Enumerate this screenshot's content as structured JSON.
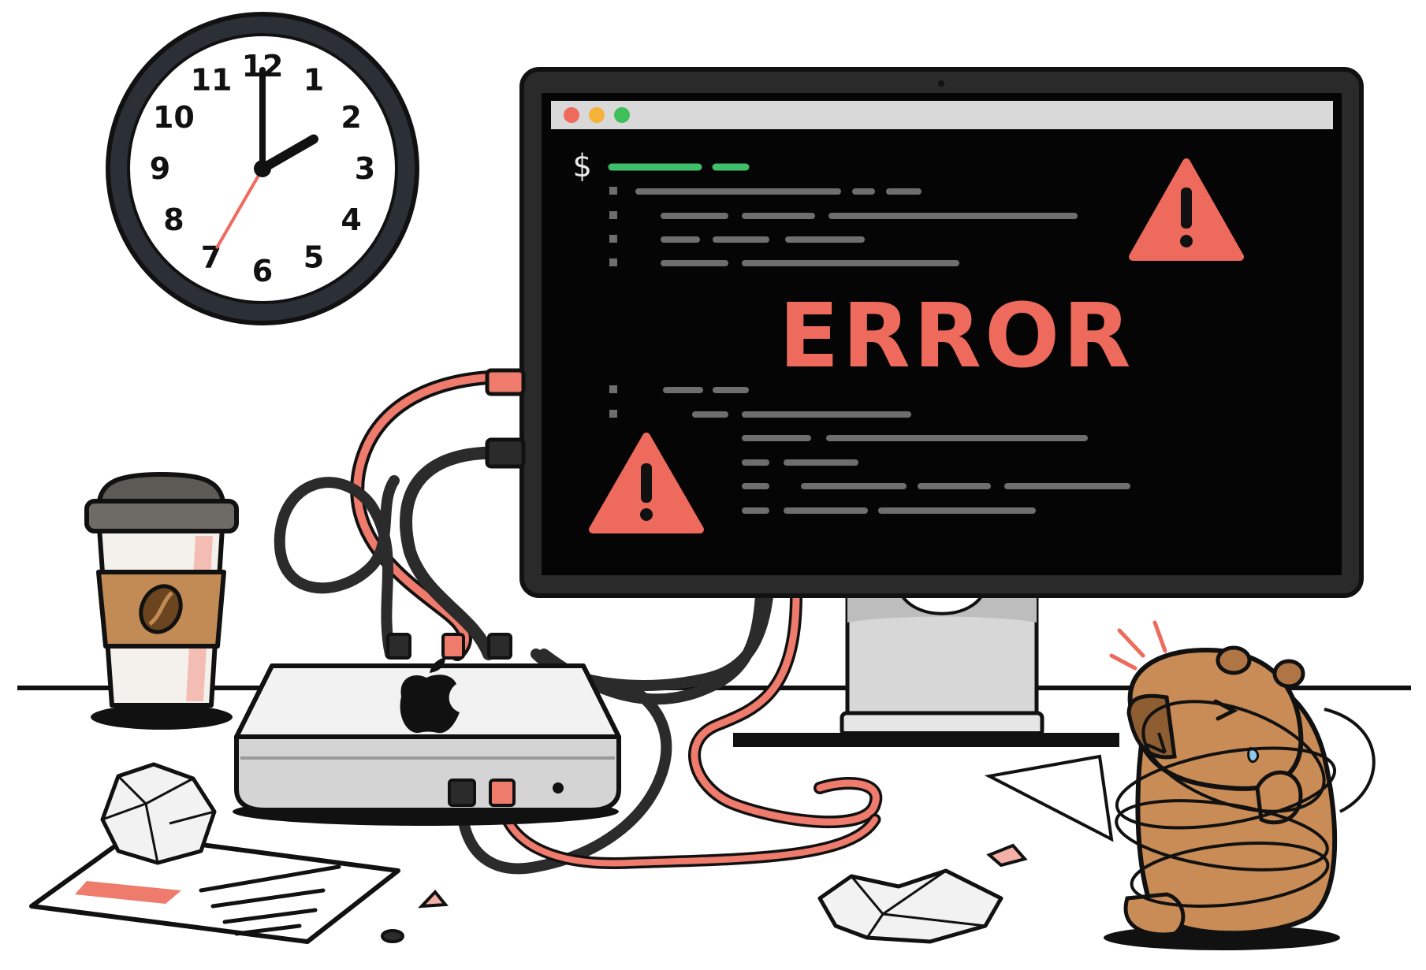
{
  "clock": {
    "numerals": [
      "12",
      "1",
      "2",
      "3",
      "4",
      "5",
      "6",
      "7",
      "8",
      "9",
      "10",
      "11"
    ],
    "time_hour": 2,
    "time_minute": 0,
    "time_second": 35,
    "hand_color": "#111111",
    "second_hand_color": "#ee6a5c"
  },
  "monitor": {
    "window_dots": [
      "close-dot-icon",
      "minimize-dot-icon",
      "maximize-dot-icon"
    ],
    "dot_colors": [
      "#ee6a5c",
      "#f5b33a",
      "#3fbf5a"
    ],
    "terminal_prompt": "$",
    "error_text": "ERROR",
    "warning_icons": [
      "warning-triangle-icon",
      "warning-triangle-icon"
    ],
    "colors": {
      "screen": "#050505",
      "bezel": "#2a2a2a",
      "error": "#ee6a5c",
      "command": "#3fbf6a",
      "log_line": "#6e6e6e"
    }
  },
  "desk_items": {
    "coffee_cup": "coffee-cup-icon",
    "mac_mini": "apple-logo-icon",
    "capybara": "tangled-capybara",
    "paper": "document-sheet",
    "crumpled_paper": "crumpled-paper"
  },
  "cable_colors": {
    "dark": "#2b2b2b",
    "red": "#ee7b6c"
  }
}
